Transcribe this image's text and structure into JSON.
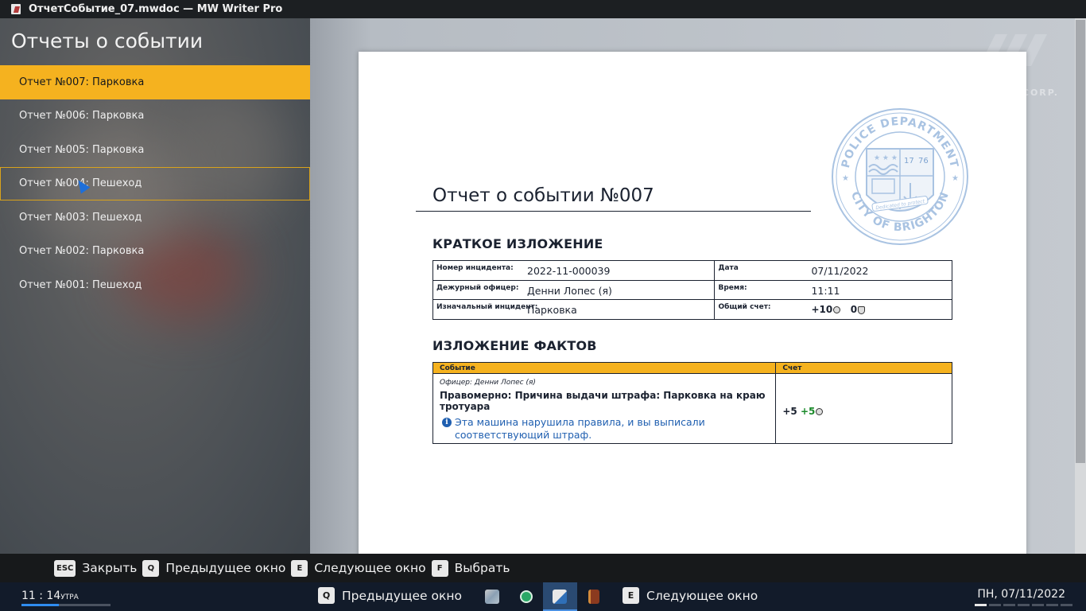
{
  "window": {
    "title": "ОтчетСобытие_07.mwdoc — MW Writer Pro"
  },
  "sidebar": {
    "heading": "Отчеты о событии",
    "items": [
      {
        "label": "Отчет №007: Парковка",
        "state": "active"
      },
      {
        "label": "Отчет №006: Парковка",
        "state": ""
      },
      {
        "label": "Отчет №005: Парковка",
        "state": ""
      },
      {
        "label": "Отчет №004: Пешеход",
        "state": "hover"
      },
      {
        "label": "Отчет №003: Пешеход",
        "state": ""
      },
      {
        "label": "Отчет №002: Парковка",
        "state": ""
      },
      {
        "label": "Отчет №001: Пешеход",
        "state": ""
      }
    ]
  },
  "corner_logo": {
    "text": "CORP."
  },
  "document": {
    "seal": {
      "top_text": "POLICE DEPARTMENT",
      "bottom_text": "CITY OF BRIGHTON",
      "year_left": "17",
      "year_right": "76",
      "motto": "Dedicated to protect"
    },
    "title": "Отчет о событии №007",
    "summary_heading": "КРАТКОЕ ИЗЛОЖЕНИЕ",
    "summary": {
      "incident_no_label": "Номер инцидента:",
      "incident_no": "2022-11-000039",
      "date_label": "Дата",
      "date": "07/11/2022",
      "officer_label": "Дежурный офицер:",
      "officer": "Денни Лопес (я)",
      "time_label": "Время:",
      "time": "11:11",
      "initial_label": "Изначальный инцидент:",
      "initial": "Парковка",
      "total_label": "Общий счет:",
      "total_points": "+10",
      "total_penalty": "0"
    },
    "facts_heading": "ИЗЛОЖЕНИЕ ФАКТОВ",
    "facts": {
      "col_event": "Событие",
      "col_score": "Счет",
      "officer": "Офицер: Денни Лопес (я)",
      "event": "Правомерно: Причина выдачи штрафа: Парковка на краю тротуара",
      "note": "Эта машина нарушила правила, и вы выписали соответствующий штраф.",
      "score_base": "+5",
      "score_bonus": "+5"
    }
  },
  "hints": [
    {
      "key": "ESC",
      "label": "Закрыть"
    },
    {
      "key": "Q",
      "label": "Предыдущее окно"
    },
    {
      "key": "E",
      "label": "Следующее окно"
    },
    {
      "key": "F",
      "label": "Выбрать"
    }
  ],
  "taskbar": {
    "clock": "11 : 14",
    "ampm": "УТРА",
    "clock_progress": 0.42,
    "prev_key": "Q",
    "prev_label": "Предыдущее окно",
    "next_key": "E",
    "next_label": "Следующее окно",
    "date": "ПН, 07/11/2022",
    "apps": [
      "map-app-icon",
      "contacts-app-icon",
      "writer-app-icon",
      "book-app-icon"
    ]
  },
  "colors": {
    "accent": "#f5b21f",
    "note_blue": "#1f5fb0",
    "taskbar": "#121b2a"
  }
}
